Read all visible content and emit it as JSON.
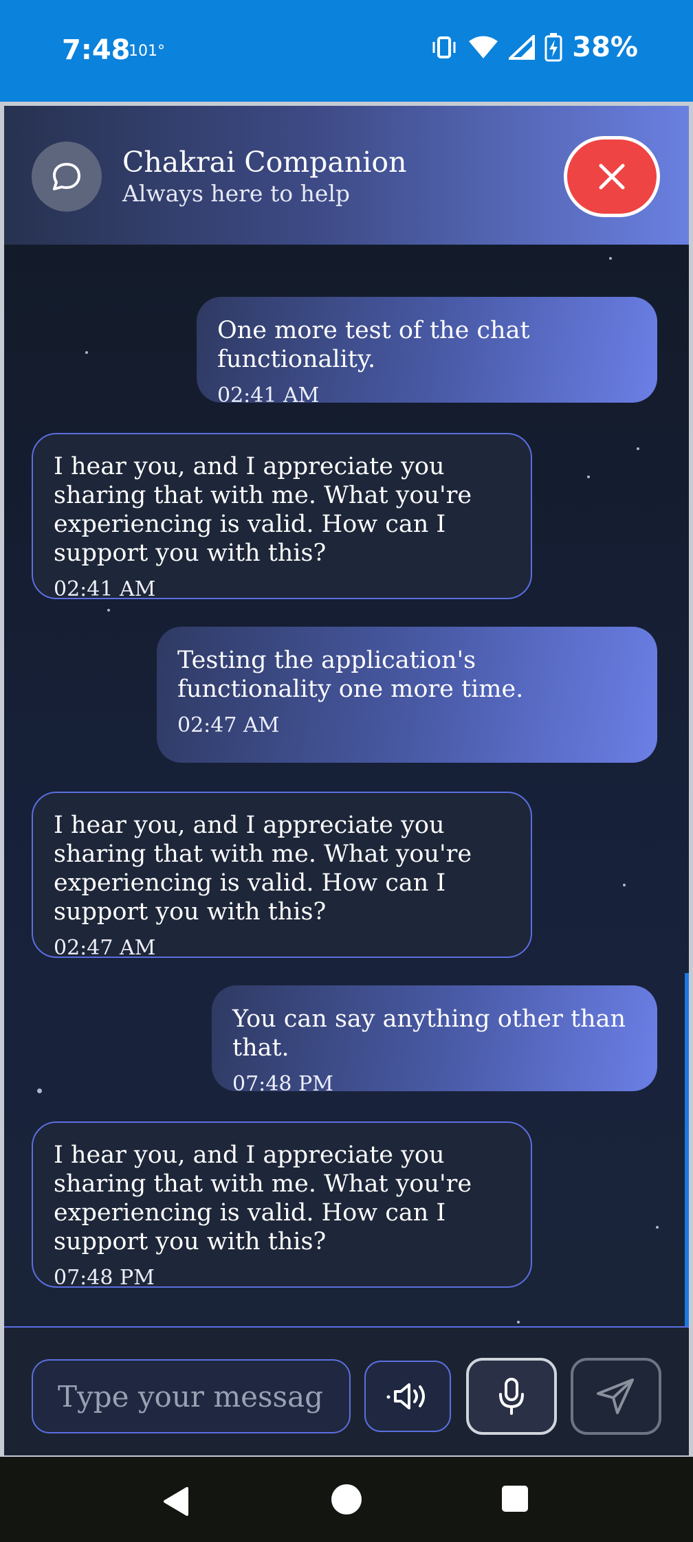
{
  "status_bar": {
    "time": "7:48",
    "temperature": "101°",
    "battery": "38%",
    "icons": [
      "vibrate-icon",
      "wifi-icon",
      "signal-icon",
      "battery-charging-icon"
    ]
  },
  "header": {
    "title": "Chakrai Companion",
    "subtitle": "Always here to help",
    "avatar_icon": "chat-bubble-icon",
    "close_icon": "close-icon",
    "accent_color": "#ef4444"
  },
  "messages": [
    {
      "sender": "user",
      "text": "One more test of the chat functionality.",
      "time": "02:41 AM"
    },
    {
      "sender": "bot",
      "text": "I hear you, and I appreciate you sharing that with me. What you're experiencing is valid. How can I support you with this?",
      "time": "02:41 AM"
    },
    {
      "sender": "user",
      "text": "Testing the application's functionality one more time.",
      "time": "02:47 AM"
    },
    {
      "sender": "bot",
      "text": "I hear you, and I appreciate you sharing that with me. What you're experiencing is valid. How can I support you with this?",
      "time": "02:47 AM"
    },
    {
      "sender": "user",
      "text": "You can say anything other than that.",
      "time": "07:48 PM"
    },
    {
      "sender": "bot",
      "text": "I hear you, and I appreciate you sharing that with me. What you're experiencing is valid. How can I support you with this?",
      "time": "07:48 PM"
    }
  ],
  "input_bar": {
    "placeholder": "Type your message",
    "value": "",
    "buttons": [
      "speaker-icon",
      "microphone-icon",
      "send-icon"
    ]
  },
  "colors": {
    "status_bar": "#0b82dc",
    "bot_border": "#5b6fe0",
    "user_gradient_end": "#6b7fe6"
  }
}
